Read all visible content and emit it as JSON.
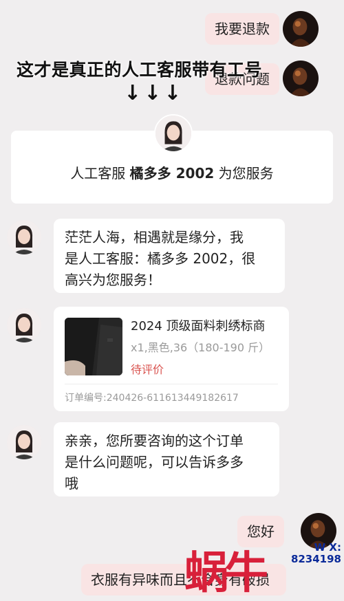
{
  "messages": {
    "m1_right": "我要退款",
    "m2_right": "退款问题",
    "overlay_title": "这才是真正的人工客服带有工号",
    "overlay_arrows": "↓↓↓",
    "notice_prefix": "人工客服",
    "notice_agent": "橘多多 2002",
    "notice_suffix": "为您服务",
    "m3_line1": "茫茫人海，相遇就是缘分，我",
    "m3_line2": "是人工客服：橘多多 2002，很",
    "m3_line3": "高兴为您服务！",
    "m5_line1": "亲亲，您所要咨询的这个订单",
    "m5_line2": "是什么问题呢，可以告诉多多",
    "m5_line3": "哦",
    "m6_right": "您好",
    "m7_right": "衣服有异味而且不合身有破损"
  },
  "order": {
    "title": "2024 顶级面料刺绣标商",
    "spec": "x1,黑色,36（180-190 斤）",
    "status": "待评价",
    "order_no": "订单编号:240426-611613449182617"
  },
  "watermark": {
    "big_text": "蜗牛",
    "small_wx": "W X:",
    "small_num": "8234198"
  },
  "colors": {
    "background": "#f0eeef",
    "right_bubble": "#f9e4e4",
    "status_red": "#d9534f",
    "watermark_red": "#d8203a",
    "watermark_blue": "#0a2a99"
  }
}
